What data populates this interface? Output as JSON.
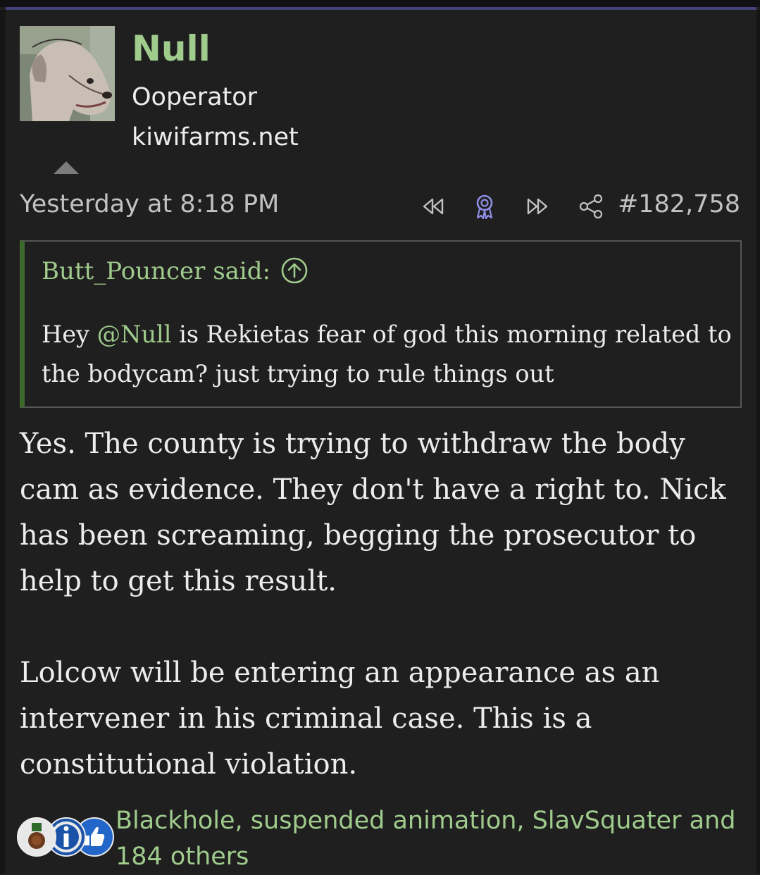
{
  "user": {
    "name": "Null",
    "title": "Ooperator",
    "site": "kiwifarms.net",
    "avatar_icon": "dog-avatar-icon"
  },
  "post": {
    "timestamp": "Yesterday at 8:18 PM",
    "number": "#182,758",
    "actions": [
      "rewind-icon",
      "award-ribbon-icon",
      "fast-forward-icon",
      "share-icon"
    ],
    "body": [
      "Yes. The county is trying to withdraw the body cam as evidence. They don't have a right to. Nick has been screaming, begging the prosecutor to help to get this result.",
      "Lolcow will be entering an appearance as an intervener in his criminal case. This is a constitutional violation."
    ]
  },
  "quote": {
    "author_said": "Butt_Pouncer said:",
    "body_before": "Hey ",
    "mention": "@Null",
    "body_after": " is Rekietas fear of god this morning related to the bodycam? just trying to rule things out"
  },
  "reactions": {
    "icons": [
      "medal-icon",
      "info-icon",
      "thumbs-up-icon"
    ],
    "text": "Blackhole, suspended animation, SlavSquater and 184 others"
  },
  "colors": {
    "background": "#1f1f1f",
    "accent_green": "#9fcb8c",
    "text": "#ececec",
    "muted": "#c2c2c2",
    "award_blue": "#8e8ee6",
    "quote_border": "#3d6a2c"
  }
}
